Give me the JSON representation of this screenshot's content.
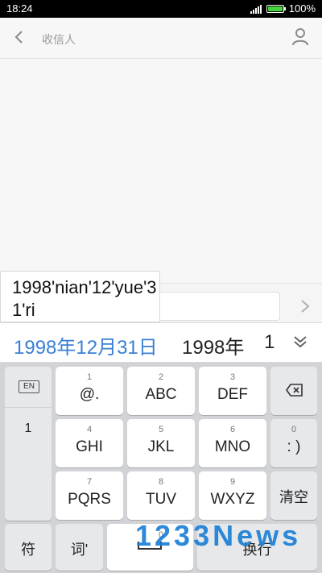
{
  "status_bar": {
    "time": "18:24",
    "battery": "100%"
  },
  "header": {
    "recipient_placeholder": "收信人"
  },
  "pinyin_popup": {
    "text": "1998'nian'12'yue'31'ri"
  },
  "candidates": [
    "1998年12月31日",
    "1998年",
    "1"
  ],
  "keyboard": {
    "en_label": "EN",
    "left_digit": "1",
    "row1": [
      {
        "num": "1",
        "label": "@."
      },
      {
        "num": "2",
        "label": "ABC"
      },
      {
        "num": "3",
        "label": "DEF"
      }
    ],
    "row2": [
      {
        "num": "4",
        "label": "GHI"
      },
      {
        "num": "5",
        "label": "JKL"
      },
      {
        "num": "6",
        "label": "MNO"
      }
    ],
    "row3": [
      {
        "num": "7",
        "label": "PQRS"
      },
      {
        "num": "8",
        "label": "TUV"
      },
      {
        "num": "9",
        "label": "WXYZ"
      }
    ],
    "smile_num": "0",
    "smile_label": ": )",
    "clear_label": "清空",
    "symbol_label": "符",
    "word_label": "词'",
    "space_num": "0",
    "enter_label": "换行",
    "backspace_icon": "backspace-icon"
  },
  "watermark": {
    "text": "1233News"
  },
  "colors": {
    "accent": "#3a7fd5",
    "battery": "#46d23c"
  }
}
